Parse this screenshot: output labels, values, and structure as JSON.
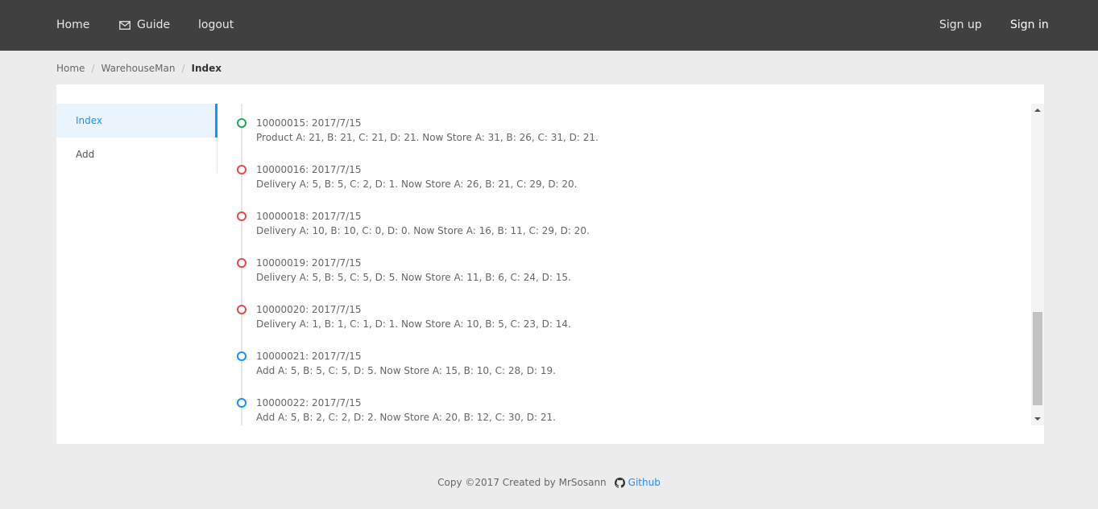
{
  "nav": {
    "home_label": "Home",
    "guide_label": "Guide",
    "logout_label": "logout",
    "signup_label": "Sign up",
    "signin_label": "Sign in",
    "guide_icon": "mail-icon"
  },
  "breadcrumb": {
    "items": [
      "Home",
      "WarehouseMan",
      "Index"
    ],
    "separator": "/"
  },
  "sidebar": {
    "items": [
      {
        "label": "Index",
        "active": true
      },
      {
        "label": "Add",
        "active": false
      }
    ]
  },
  "timeline": {
    "items": [
      {
        "title": "10000015: 2017/7/15",
        "desc": "Product A: 21, B: 21, C: 21, D: 21. Now Store A: 31, B: 26, C: 31, D: 21.",
        "color": "#1aab5c"
      },
      {
        "title": "10000016: 2017/7/15",
        "desc": "Delivery A: 5, B: 5, C: 2, D: 1. Now Store A: 26, B: 21, C: 29, D: 20.",
        "color": "#e64a4a"
      },
      {
        "title": "10000018: 2017/7/15",
        "desc": "Delivery A: 10, B: 10, C: 0, D: 0. Now Store A: 16, B: 11, C: 29, D: 20.",
        "color": "#e64a4a"
      },
      {
        "title": "10000019: 2017/7/15",
        "desc": "Delivery A: 5, B: 5, C: 5, D: 5. Now Store A: 11, B: 6, C: 24, D: 15.",
        "color": "#e64a4a"
      },
      {
        "title": "10000020: 2017/7/15",
        "desc": "Delivery A: 1, B: 1, C: 1, D: 1. Now Store A: 10, B: 5, C: 23, D: 14.",
        "color": "#e64a4a"
      },
      {
        "title": "10000021: 2017/7/15",
        "desc": "Add A: 5, B: 5, C: 5, D: 5. Now Store A: 15, B: 10, C: 28, D: 19.",
        "color": "#1890ff"
      },
      {
        "title": "10000022: 2017/7/15",
        "desc": "Add A: 5, B: 2, C: 2, D: 2. Now Store A: 20, B: 12, C: 30, D: 21.",
        "color": "#1890ff"
      }
    ]
  },
  "footer": {
    "copyright": "Copy ©2017 Created by MrSosann",
    "github_label": "Github",
    "github_icon": "github-icon"
  }
}
